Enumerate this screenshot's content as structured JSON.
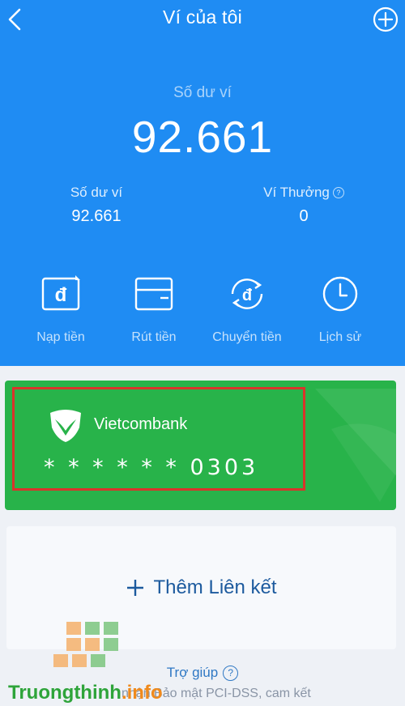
{
  "header": {
    "title": "Ví của tôi",
    "back_icon": "chevron-left-icon",
    "add_icon": "plus-circle-icon"
  },
  "balance": {
    "label": "Số dư ví",
    "value": "92.661"
  },
  "sub_balances": [
    {
      "label": "Số dư ví",
      "value": "92.661"
    },
    {
      "label": "Ví Thưởng",
      "value": "0"
    }
  ],
  "actions": [
    {
      "label": "Nạp tiền",
      "icon": "deposit-icon"
    },
    {
      "label": "Rút tiền",
      "icon": "withdraw-icon"
    },
    {
      "label": "Chuyển tiền",
      "icon": "transfer-icon"
    },
    {
      "label": "Lịch sử",
      "icon": "history-clock-icon"
    }
  ],
  "bank_card": {
    "bank_name": "Vietcombank",
    "account_masked": "* * * * * * 0303",
    "logo_icon": "vietcombank-logo-icon"
  },
  "add_link": {
    "label": "Thêm Liên kết"
  },
  "help": {
    "label": "Trợ giúp"
  },
  "footer_notice": {
    "line1": "nhận Bảo mật PCI-DSS, cam kết"
  },
  "watermark": {
    "part1": "Truongthinh",
    "part2": ".info"
  },
  "colors": {
    "header_blue": "#1f8cf3",
    "card_green": "#28b34a",
    "highlight_red": "#d9342b",
    "link_blue": "#1c5a9e"
  }
}
